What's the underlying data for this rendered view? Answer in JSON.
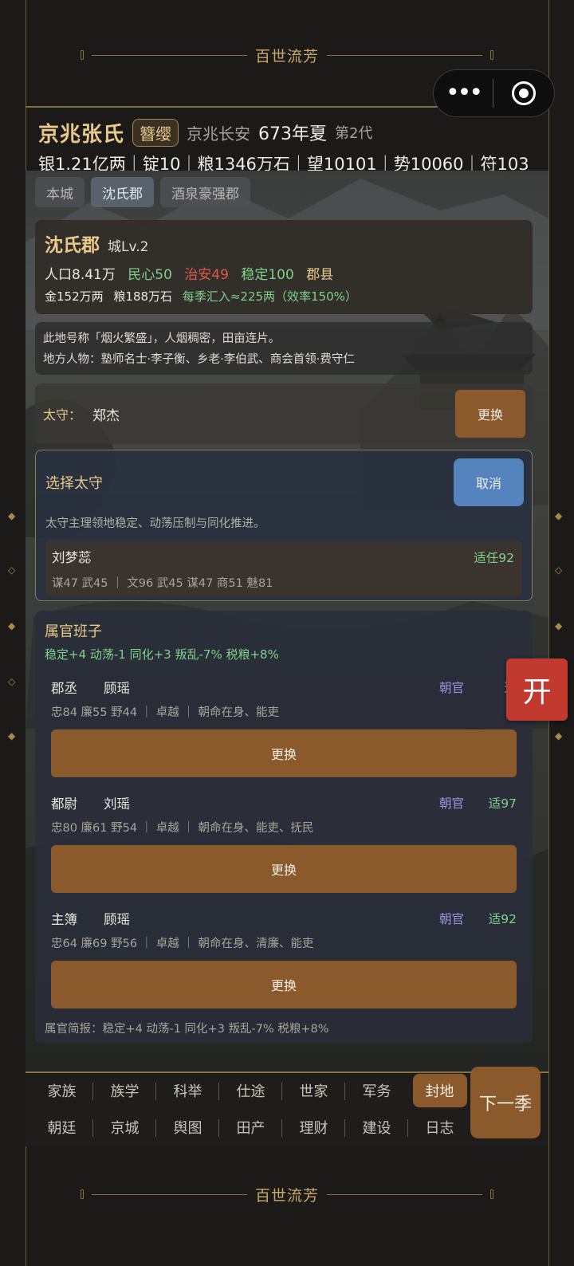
{
  "banner": {
    "title": "百世流芳"
  },
  "header": {
    "clan_name": "京兆张氏",
    "badge": "簪缨",
    "location": "京兆长安",
    "year": "673年夏",
    "generation": "第2代",
    "resources": "银1.21亿两｜锭10｜粮1346万石｜望10101｜势10060｜符103"
  },
  "tabs": [
    {
      "label": "本城"
    },
    {
      "label": "沈氏郡"
    },
    {
      "label": "酒泉豪强郡"
    }
  ],
  "fief": {
    "name": "沈氏郡",
    "level": "城Lv.2",
    "population": "人口8.41万",
    "morale": "民心50",
    "order": "治安49",
    "stability": "稳定100",
    "type": "郡县",
    "gold": "金152万两",
    "grain": "粮188万石",
    "income": "每季汇入≈225两（效率150%）"
  },
  "description": {
    "line1": "此地号称「烟火繁盛」，人烟稠密，田亩连片。",
    "line2": "地方人物：塾师名士·李子衡、乡老·李伯武、商会首领·费守仁"
  },
  "governor": {
    "label": "太守：",
    "name": "郑杰",
    "change_label": "更换"
  },
  "select_governor": {
    "title": "选择太守",
    "cancel_label": "取消",
    "note": "太守主理领地稳定、动荡压制与同化推进。",
    "candidate": {
      "name": "刘梦蕊",
      "fit": "适任92",
      "stats": "谋47 武45 ｜ 文96 武45 谋47 商51 魅81"
    }
  },
  "staff": {
    "title": "属官班子",
    "effects": "稳定+4  动荡-1  同化+3  叛乱-7%  税粮+8%",
    "officers": [
      {
        "position": "郡丞",
        "name": "顾瑶",
        "tag": "朝官",
        "fit": "适",
        "attrs": "忠84 廉55 野44 ｜ 卓越 ｜ 朝命在身、能吏",
        "button": "更换"
      },
      {
        "position": "都尉",
        "name": "刘瑶",
        "tag": "朝官",
        "fit": "适97",
        "attrs": "忠80 廉61 野54 ｜ 卓越 ｜ 朝命在身、能吏、抚民",
        "button": "更换"
      },
      {
        "position": "主簿",
        "name": "顾瑶",
        "tag": "朝官",
        "fit": "适92",
        "attrs": "忠64 廉69 野56 ｜ 卓越 ｜ 朝命在身、清廉、能吏",
        "button": "更换"
      }
    ],
    "brief": "属官简报：稳定+4  动荡-1  同化+3  叛乱-7%  税粮+8%"
  },
  "float_button": {
    "label": "开"
  },
  "nav": {
    "row1": [
      {
        "label": "家族"
      },
      {
        "label": "族学"
      },
      {
        "label": "科举"
      },
      {
        "label": "仕途"
      },
      {
        "label": "世家"
      },
      {
        "label": "军务"
      },
      {
        "label": "封地"
      }
    ],
    "row2": [
      {
        "label": "朝廷"
      },
      {
        "label": "京城"
      },
      {
        "label": "舆图"
      },
      {
        "label": "田产"
      },
      {
        "label": "理财"
      },
      {
        "label": "建设"
      },
      {
        "label": "日志"
      }
    ],
    "next_label": "下一季"
  },
  "colors": {
    "gold": "#e8c98a",
    "brown_button": "#8a5a2c",
    "blue_button": "#5483bd",
    "positive": "#7dd28a",
    "negative": "#e2574c",
    "float_red": "#c1392f"
  }
}
